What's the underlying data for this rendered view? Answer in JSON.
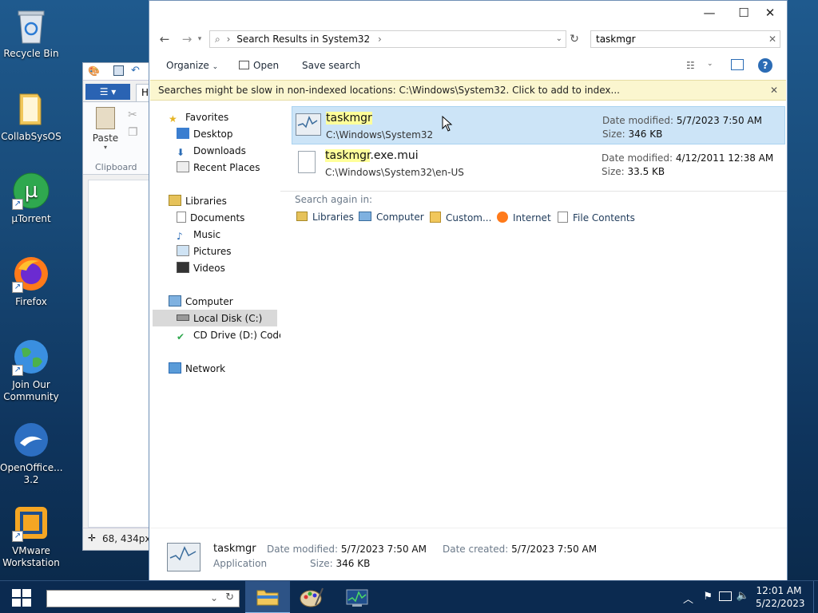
{
  "desktop": {
    "icons": [
      {
        "label": "Recycle Bin",
        "icon": "recycle-bin-icon"
      },
      {
        "label": "CollabSysOS",
        "icon": "folder-icon"
      },
      {
        "label": "µTorrent",
        "icon": "utorrent-icon"
      },
      {
        "label": "Firefox",
        "icon": "firefox-icon"
      },
      {
        "label": "Join Our Community",
        "icon": "globe-icon"
      },
      {
        "label": "OpenOffice... 3.2",
        "icon": "openoffice-icon"
      },
      {
        "label": "VMware Workstation",
        "icon": "vmware-icon"
      }
    ]
  },
  "paint": {
    "tab_label": "H",
    "paste_label": "Paste",
    "clipboard_label": "Clipboard",
    "status_coords": "68, 434px"
  },
  "explorer": {
    "address": {
      "path": "Search Results in System32"
    },
    "search": {
      "value": "taskmgr"
    },
    "commands": {
      "organize": "Organize",
      "open": "Open",
      "save_search": "Save search"
    },
    "infobar": "Searches might be slow in non-indexed locations: C:\\Windows\\System32. Click to add to index...",
    "nav": {
      "favorites": "Favorites",
      "desktop": "Desktop",
      "downloads": "Downloads",
      "recent": "Recent Places",
      "libraries": "Libraries",
      "documents": "Documents",
      "music": "Music",
      "pictures": "Pictures",
      "videos": "Videos",
      "computer": "Computer",
      "local_disk": "Local Disk (C:)",
      "cd_drive": "CD Drive (D:) Coden",
      "network": "Network"
    },
    "results": [
      {
        "name_hl": "taskmgr",
        "name_rest": "",
        "path": "C:\\Windows\\System32",
        "modified_label": "Date modified:",
        "modified": "5/7/2023 7:50 AM",
        "size_label": "Size:",
        "size": "346 KB"
      },
      {
        "name_hl": "taskmgr",
        "name_rest": ".exe.mui",
        "path": "C:\\Windows\\System32\\en-US",
        "modified_label": "Date modified:",
        "modified": "4/12/2011 12:38 AM",
        "size_label": "Size:",
        "size": "33.5 KB"
      }
    ],
    "search_again": {
      "label": "Search again in:",
      "items": [
        "Libraries",
        "Computer",
        "Custom...",
        "Internet",
        "File Contents"
      ]
    },
    "details": {
      "name": "taskmgr",
      "type": "Application",
      "modified_label": "Date modified:",
      "modified": "5/7/2023 7:50 AM",
      "created_label": "Date created:",
      "created": "5/7/2023 7:50 AM",
      "size_label": "Size:",
      "size": "346 KB"
    }
  },
  "taskbar": {
    "time": "12:01 AM",
    "date": "5/22/2023"
  }
}
